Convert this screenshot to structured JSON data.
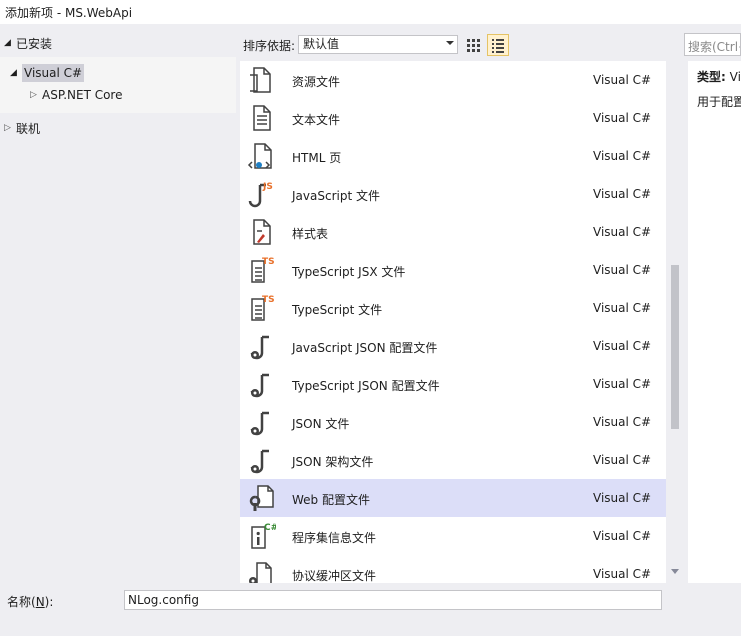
{
  "window": {
    "title": "添加新项 - MS.WebApi"
  },
  "tree": {
    "installed": "已安装",
    "visual_csharp": "Visual C#",
    "aspnet_core": "ASP.NET Core",
    "online": "联机"
  },
  "toolbar": {
    "sort_label": "排序依据:",
    "sort_value": "默认值"
  },
  "search": {
    "placeholder": "搜索(Ctrl+E)"
  },
  "items": [
    {
      "name": "资源文件",
      "lang": "Visual C#",
      "icon": "resource-file-icon"
    },
    {
      "name": "文本文件",
      "lang": "Visual C#",
      "icon": "text-file-icon"
    },
    {
      "name": "HTML 页",
      "lang": "Visual C#",
      "icon": "html-page-icon"
    },
    {
      "name": "JavaScript 文件",
      "lang": "Visual C#",
      "icon": "javascript-file-icon"
    },
    {
      "name": "样式表",
      "lang": "Visual C#",
      "icon": "stylesheet-icon"
    },
    {
      "name": "TypeScript JSX 文件",
      "lang": "Visual C#",
      "icon": "typescript-jsx-file-icon"
    },
    {
      "name": "TypeScript 文件",
      "lang": "Visual C#",
      "icon": "typescript-file-icon"
    },
    {
      "name": "JavaScript JSON 配置文件",
      "lang": "Visual C#",
      "icon": "json-config-icon"
    },
    {
      "name": "TypeScript JSON 配置文件",
      "lang": "Visual C#",
      "icon": "json-config-icon"
    },
    {
      "name": "JSON 文件",
      "lang": "Visual C#",
      "icon": "json-file-icon"
    },
    {
      "name": "JSON 架构文件",
      "lang": "Visual C#",
      "icon": "json-schema-icon"
    },
    {
      "name": "Web 配置文件",
      "lang": "Visual C#",
      "icon": "web-config-icon"
    },
    {
      "name": "程序集信息文件",
      "lang": "Visual C#",
      "icon": "assembly-info-icon"
    },
    {
      "name": "协议缓冲区文件",
      "lang": "Visual C#",
      "icon": "protobuf-file-icon"
    }
  ],
  "selected_index": 11,
  "details": {
    "type_label": "类型:",
    "type_value": "Visual C#",
    "description": "用于配置"
  },
  "name_field": {
    "label_prefix": "名称(",
    "label_key": "N",
    "label_suffix": "):",
    "value": "NLog.config"
  },
  "colors": {
    "selected_row": "#dcdef8",
    "js_badge": "#e8702a",
    "ts_badge": "#e8702a",
    "cs_badge": "#388a34",
    "html_blue": "#1e7fc4"
  }
}
